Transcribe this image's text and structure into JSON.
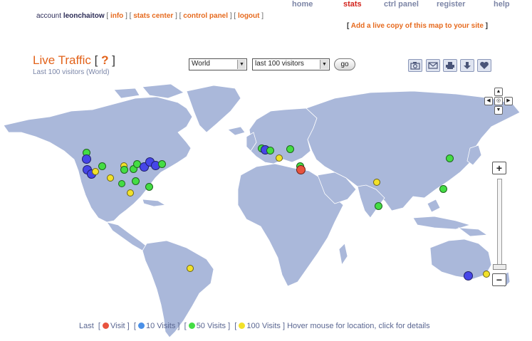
{
  "nav": {
    "items": [
      {
        "label": "home"
      },
      {
        "label": "stats"
      },
      {
        "label": "ctrl panel"
      },
      {
        "label": "register"
      },
      {
        "label": "help"
      }
    ]
  },
  "account": {
    "prefix": "account",
    "username": "leonchaitow",
    "links": [
      "info",
      "stats center",
      "control panel",
      "logout"
    ]
  },
  "promo": {
    "link": "Add a live copy of this map to your site"
  },
  "header": {
    "title": "Live Traffic",
    "help": "?",
    "subtitle": "Last 100 visitors (World)"
  },
  "controls": {
    "region_select": "World",
    "visitors_select": "last 100 visitors",
    "go_label": "go"
  },
  "toolbar": {
    "icons": [
      "camera-icon",
      "email-icon",
      "print-icon",
      "download-icon",
      "heart-icon"
    ]
  },
  "legend": {
    "prefix": "Last",
    "items": [
      {
        "label": "Visit",
        "color": "#e8533e"
      },
      {
        "label": "10 Visits",
        "color": "#4a90e8"
      },
      {
        "label": "50 Visits",
        "color": "#44dd44"
      },
      {
        "label": "100 Visits",
        "color": "#f2e12a"
      }
    ],
    "hint": "Hover mouse for location, click for details"
  },
  "colors": {
    "land": "#aab8da",
    "ocean": "#ffffff",
    "accent": "#e2621a"
  }
}
